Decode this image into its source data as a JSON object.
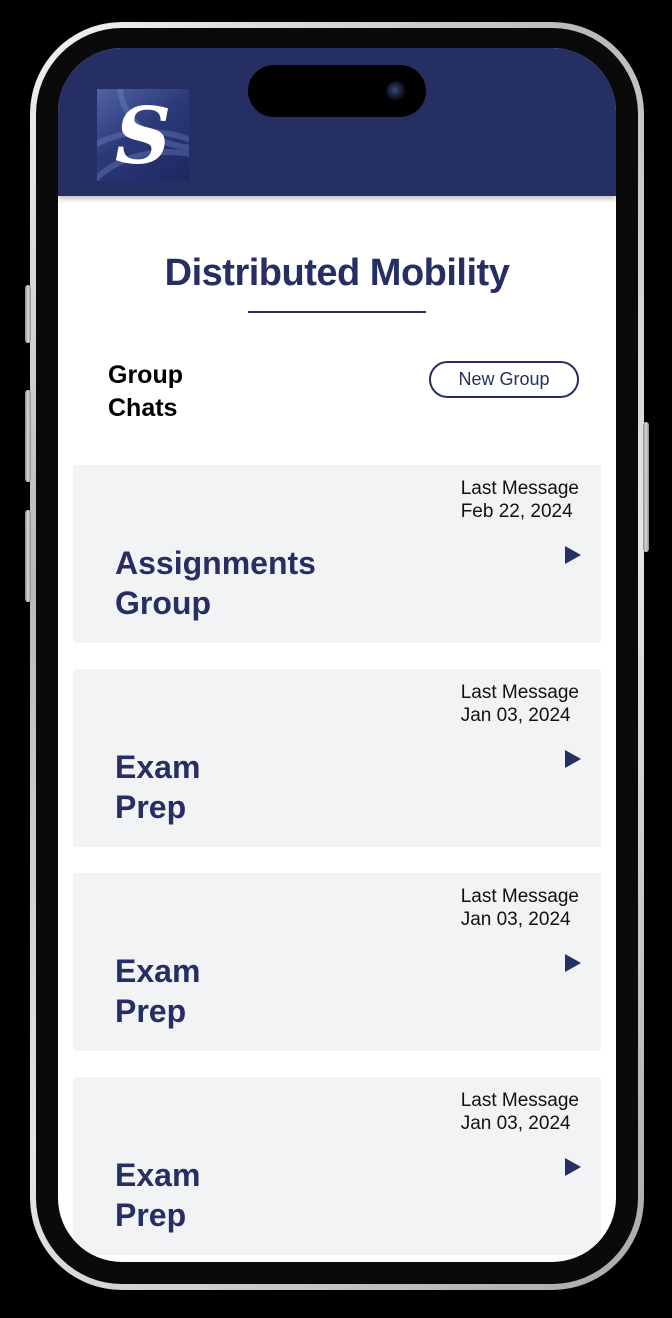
{
  "app": {
    "logo_letter": "S",
    "title": "Distributed Mobility"
  },
  "section": {
    "label": "Group Chats",
    "new_group_label": "New Group"
  },
  "groups": [
    {
      "name": "Assignments Group",
      "meta_label": "Last Message",
      "date": "Feb 22, 2024"
    },
    {
      "name": "Exam Prep",
      "meta_label": "Last Message",
      "date": "Jan 03, 2024"
    },
    {
      "name": "Exam Prep",
      "meta_label": "Last Message",
      "date": "Jan 03, 2024"
    },
    {
      "name": "Exam Prep",
      "meta_label": "Last Message",
      "date": "Jan 03, 2024"
    }
  ],
  "icons": {
    "open_group": "play-arrow-icon"
  },
  "colors": {
    "brand": "#262f63",
    "card_bg": "#f2f3f5",
    "page_bg": "#ffffff"
  }
}
